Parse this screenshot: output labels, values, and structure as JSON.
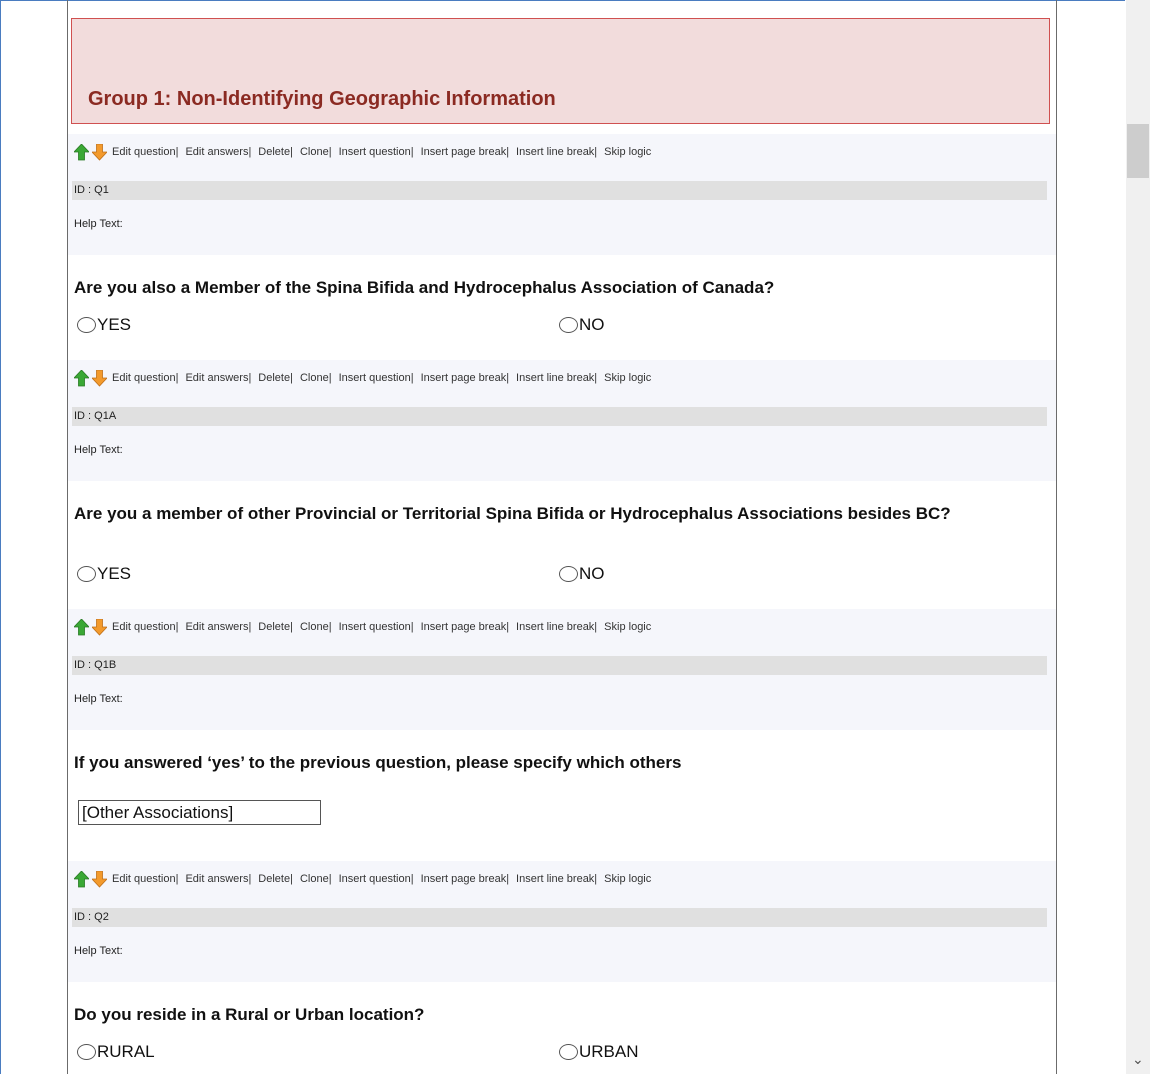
{
  "group": {
    "title": "Group 1: Non-Identifying Geographic Information"
  },
  "toolbar": {
    "links": [
      "Edit question|",
      "Edit answers|",
      "Delete|",
      "Clone|",
      "Insert question|",
      "Insert page break|",
      "Insert line break|",
      "Skip logic"
    ],
    "icons": [
      "move-up-arrow-icon",
      "move-down-arrow-icon"
    ],
    "up_color": "#3aa835",
    "down_color": "#f39a2c"
  },
  "questions": [
    {
      "id": "ID : Q1",
      "help": "Help Text:",
      "text": "Are you also a Member of the Spina Bifida and Hydrocephalus Association of Canada?",
      "options": [
        "YES",
        "NO"
      ]
    },
    {
      "id": "ID : Q1A",
      "help": "Help Text:",
      "text": "Are you a member of other Provincial or Territorial Spina Bifida or Hydrocephalus Associations besides BC?",
      "options": [
        "YES",
        "NO"
      ]
    },
    {
      "id": "ID : Q1B",
      "help": "Help Text:",
      "text": "If you answered ‘yes’ to the previous question, please specify which others",
      "input_value": "[Other Associations]"
    },
    {
      "id": "ID : Q2",
      "help": "Help Text:",
      "text": "Do you reside in a Rural or Urban location?",
      "options": [
        "RURAL",
        "URBAN"
      ]
    }
  ]
}
